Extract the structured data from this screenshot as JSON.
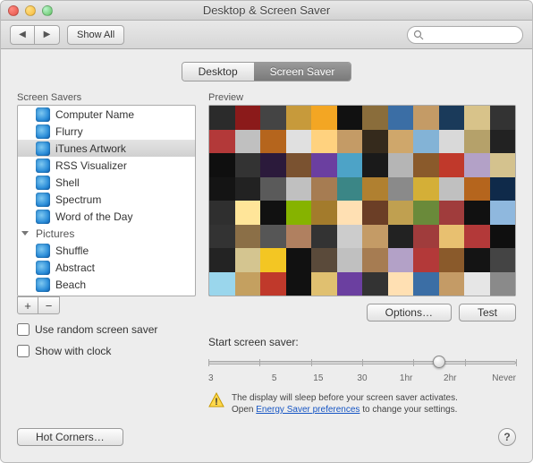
{
  "window": {
    "title": "Desktop & Screen Saver"
  },
  "toolbar": {
    "show_all": "Show All",
    "search_placeholder": ""
  },
  "tabs": {
    "desktop": "Desktop",
    "screensaver": "Screen Saver"
  },
  "left": {
    "header": "Screen Savers",
    "items": [
      {
        "label": "Computer Name"
      },
      {
        "label": "Flurry"
      },
      {
        "label": "iTunes Artwork",
        "selected": true
      },
      {
        "label": "RSS Visualizer"
      },
      {
        "label": "Shell"
      },
      {
        "label": "Spectrum"
      },
      {
        "label": "Word of the Day"
      }
    ],
    "group": "Pictures",
    "pics": [
      {
        "label": "Shuffle"
      },
      {
        "label": "Abstract"
      },
      {
        "label": "Beach"
      }
    ],
    "plus": "+",
    "minus": "−",
    "random": "Use random screen saver",
    "clock": "Show with clock"
  },
  "right": {
    "header": "Preview",
    "options": "Options…",
    "test": "Test",
    "slider_label": "Start screen saver:",
    "ticks": [
      "3",
      "5",
      "15",
      "30",
      "1hr",
      "2hr",
      "Never"
    ],
    "warn1": "The display will sleep before your screen saver activates.",
    "warn2a": "Open ",
    "warn2link": "Energy Saver preferences",
    "warn2b": " to change your settings."
  },
  "bottom": {
    "hotcorners": "Hot Corners…",
    "help": "?"
  },
  "preview_colors": [
    "#2b2b2b",
    "#8b1a1a",
    "#444",
    "#c79a3b",
    "#f3a623",
    "#111",
    "#8a6d3b",
    "#3b6ea5",
    "#c49b66",
    "#1a3a5a",
    "#d8c38a",
    "#333",
    "#b33939",
    "#c0c0c0",
    "#b5651d",
    "#e0e0e0",
    "#ffd27f",
    "#c49b66",
    "#352a1c",
    "#cfa76b",
    "#83b3d6",
    "#d9d9d9",
    "#b5a16a",
    "#222",
    "#0f0f0f",
    "#333",
    "#2b1a3b",
    "#7a5230",
    "#6b3fa0",
    "#4da3c7",
    "#1a1a1a",
    "#b5b5b5",
    "#8a5a2b",
    "#c0392b",
    "#b3a1c7",
    "#d4c28e",
    "#141414",
    "#222",
    "#5a5a5a",
    "#c0c0c0",
    "#a67c52",
    "#3b8686",
    "#b08030",
    "#8a8a8a",
    "#d4af37",
    "#c0c0c0",
    "#b5651d",
    "#0f2a4a",
    "#2f2f2f",
    "#ffe599",
    "#111",
    "#86b300",
    "#a37b2c",
    "#ffe0b3",
    "#6b3e26",
    "#c0a050",
    "#6a8a3a",
    "#a03c3c",
    "#111",
    "#8fb8de",
    "#333",
    "#8b6f47",
    "#565656",
    "#b08060",
    "#333",
    "#ccc",
    "#c49b66",
    "#222",
    "#a03c3c",
    "#e8c070",
    "#b33939",
    "#0f0f0f",
    "#232323",
    "#d4c590",
    "#f3c623",
    "#111",
    "#5a4a3a",
    "#c0c0c0",
    "#a67c52",
    "#b3a1c7",
    "#b33939",
    "#8a5a2b",
    "#141414",
    "#444",
    "#9ad6ec",
    "#c4a060",
    "#c0392b",
    "#111",
    "#e0c070",
    "#6b3fa0",
    "#333",
    "#ffe0b3",
    "#3b6ea5",
    "#c49b66",
    "#e6e6e6",
    "#8a8a8a"
  ]
}
